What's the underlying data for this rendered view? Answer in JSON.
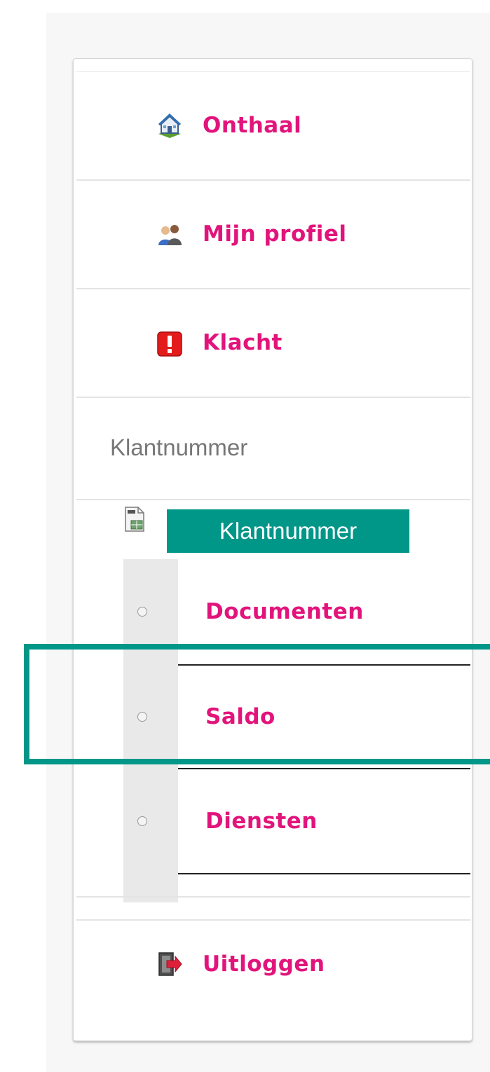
{
  "nav": {
    "items": [
      {
        "label": "Onthaal",
        "icon": "home-icon"
      },
      {
        "label": "Mijn profiel",
        "icon": "users-icon"
      },
      {
        "label": "Klacht",
        "icon": "warning-icon"
      }
    ],
    "logout": {
      "label": "Uitloggen",
      "icon": "logout-door-icon"
    }
  },
  "account": {
    "section_title": "Klantnummer",
    "selected_customer": "Klantnummer",
    "sub_items": [
      {
        "label": "Documenten"
      },
      {
        "label": "Saldo"
      },
      {
        "label": "Diensten"
      }
    ]
  },
  "colors": {
    "link": "#e2147b",
    "accent": "#009688",
    "muted_text": "#777777"
  }
}
